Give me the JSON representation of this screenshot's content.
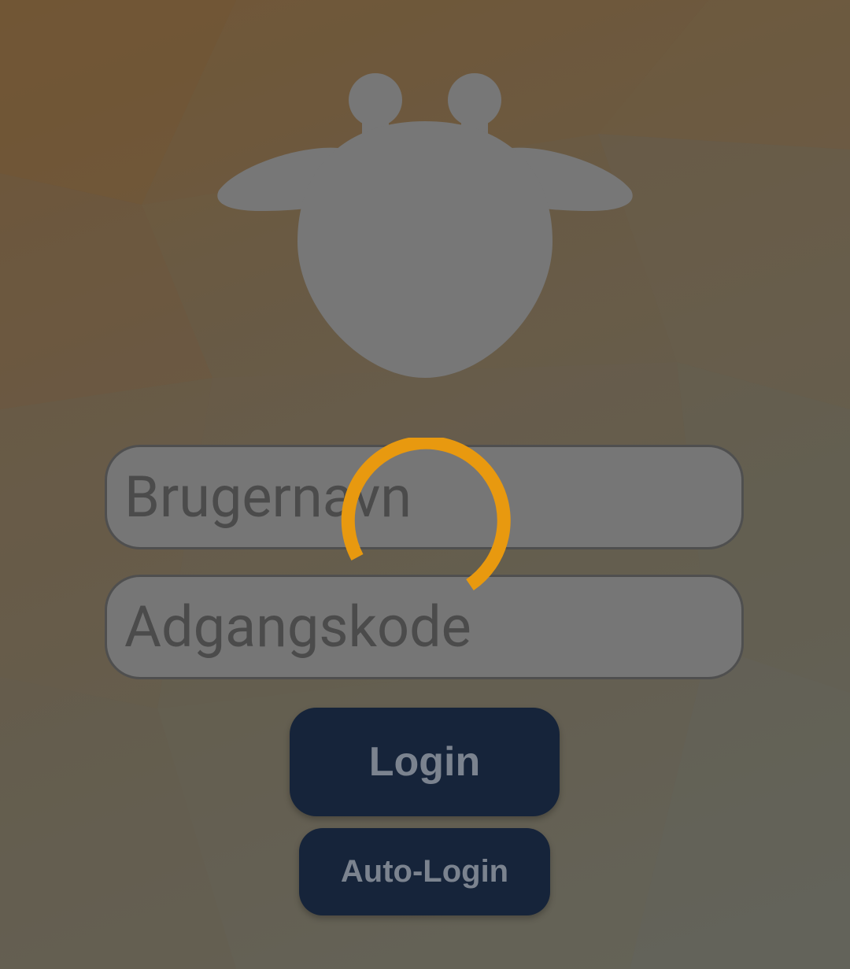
{
  "login_form": {
    "username_placeholder": "Brugernavn",
    "password_placeholder": "Adgangskode"
  },
  "buttons": {
    "login_label": "Login",
    "auto_login_label": "Auto-Login"
  },
  "icons": {
    "logo": "giraffe-head-logo-icon",
    "spinner": "loading-spinner-icon"
  },
  "colors": {
    "spinner": "#e8990f",
    "button_bg": "#16243a",
    "button_text": "#7b838f",
    "field_bg": "#767676"
  }
}
